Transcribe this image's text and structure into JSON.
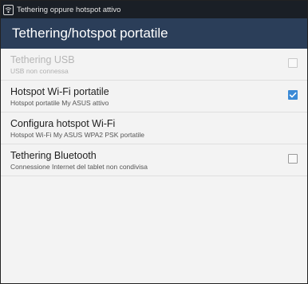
{
  "status_bar": {
    "icon": "tethering-icon",
    "text": "Tethering oppure hotspot attivo"
  },
  "action_bar": {
    "title": "Tethering/hotspot portatile"
  },
  "items": [
    {
      "title": "Tethering USB",
      "summary": "USB non connessa",
      "enabled": false,
      "checked": false
    },
    {
      "title": "Hotspot Wi-Fi portatile",
      "summary": "Hotspot portatile My ASUS attivo",
      "enabled": true,
      "checked": true
    },
    {
      "title": "Configura hotspot Wi-Fi",
      "summary": "Hotspot Wi-Fi My ASUS WPA2 PSK portatile",
      "enabled": true
    },
    {
      "title": "Tethering Bluetooth",
      "summary": "Connessione Internet del tablet non condivisa",
      "enabled": true,
      "checked": false
    }
  ],
  "colors": {
    "status_bar": "#1a1f26",
    "action_bar": "#2b3e59",
    "checkbox_checked": "#3b8ad6"
  }
}
